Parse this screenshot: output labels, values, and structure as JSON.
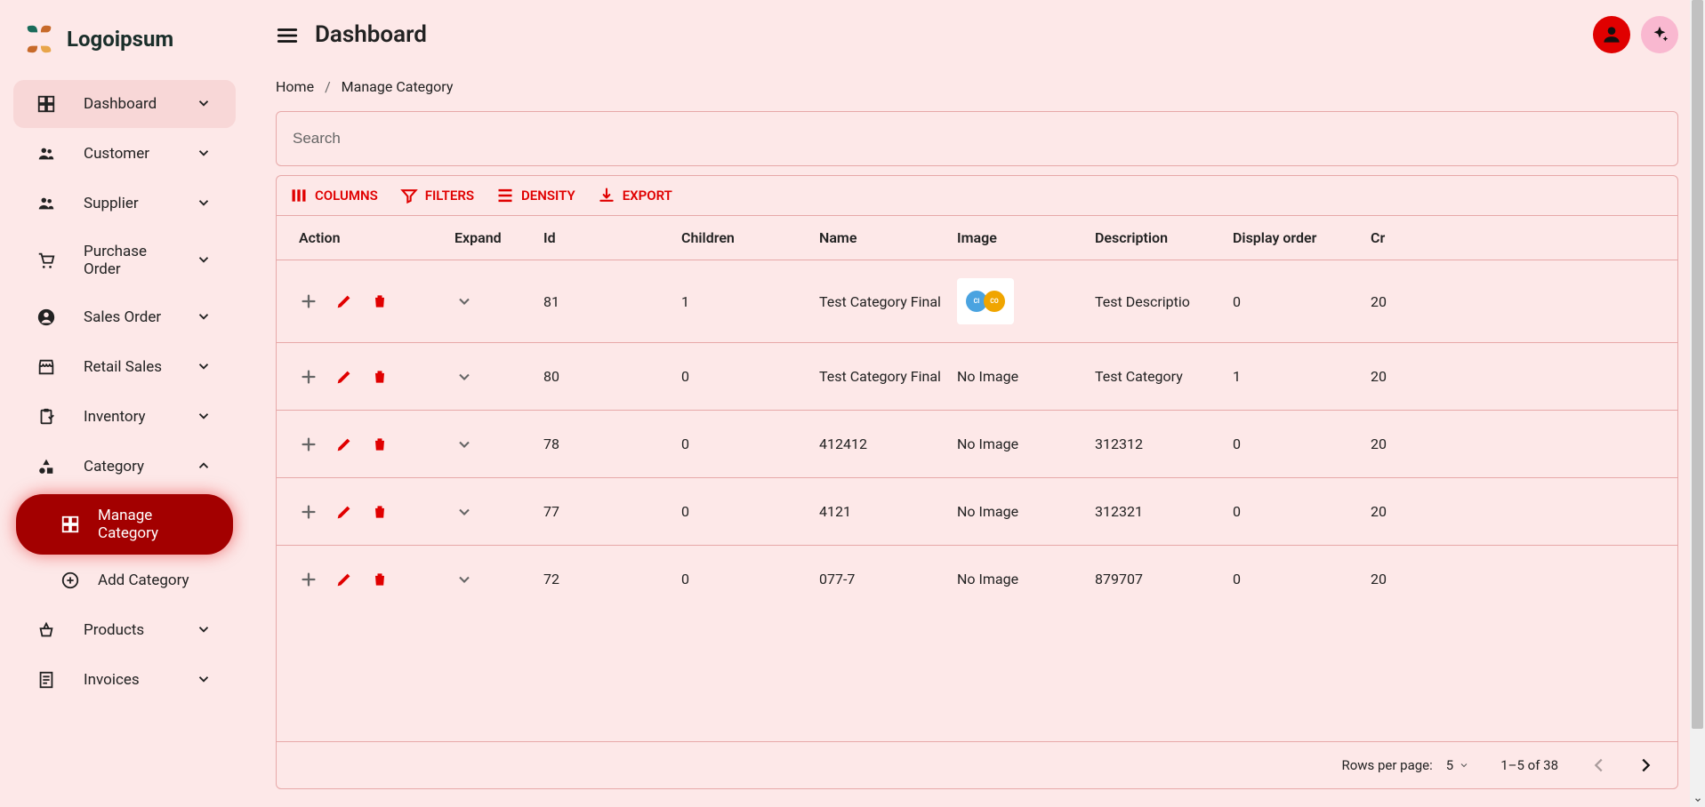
{
  "brand": "Logoipsum",
  "header": {
    "title": "Dashboard"
  },
  "breadcrumb": {
    "home": "Home",
    "current": "Manage Category"
  },
  "search": {
    "placeholder": "Search"
  },
  "sidebar": {
    "items": [
      {
        "label": "Dashboard",
        "icon": "dashboard"
      },
      {
        "label": "Customer",
        "icon": "group"
      },
      {
        "label": "Supplier",
        "icon": "group"
      },
      {
        "label": "Purchase Order",
        "icon": "cart"
      },
      {
        "label": "Sales Order",
        "icon": "account"
      },
      {
        "label": "Retail Sales",
        "icon": "store"
      },
      {
        "label": "Inventory",
        "icon": "clipboard"
      },
      {
        "label": "Category",
        "icon": "shapes",
        "expanded": true
      },
      {
        "label": "Products",
        "icon": "basket"
      },
      {
        "label": "Invoices",
        "icon": "receipt"
      }
    ],
    "category_children": [
      {
        "label": "Manage Category",
        "active": true,
        "icon": "dashboard"
      },
      {
        "label": "Add Category",
        "active": false,
        "icon": "plus-circle"
      }
    ]
  },
  "toolbar": {
    "columns": "COLUMNS",
    "filters": "FILTERS",
    "density": "DENSITY",
    "export": "EXPORT"
  },
  "table": {
    "headers": {
      "action": "Action",
      "expand": "Expand",
      "id": "Id",
      "children": "Children",
      "name": "Name",
      "image": "Image",
      "description": "Description",
      "display_order": "Display order",
      "created": "Cr"
    },
    "rows": [
      {
        "id": "81",
        "children": "1",
        "name": "Test Category Final",
        "image": "thumb",
        "description": "Test Descriptio",
        "order": "0",
        "cr": "20"
      },
      {
        "id": "80",
        "children": "0",
        "name": "Test Category Final",
        "image": "none",
        "description": "Test Category",
        "order": "1",
        "cr": "20"
      },
      {
        "id": "78",
        "children": "0",
        "name": "412412",
        "image": "none",
        "description": "312312",
        "order": "0",
        "cr": "20"
      },
      {
        "id": "77",
        "children": "0",
        "name": "4121",
        "image": "none",
        "description": "312321",
        "order": "0",
        "cr": "20"
      },
      {
        "id": "72",
        "children": "0",
        "name": "077-7",
        "image": "none",
        "description": "879707",
        "order": "0",
        "cr": "20"
      }
    ],
    "no_image_text": "No Image"
  },
  "pagination": {
    "rows_per_page_label": "Rows per page:",
    "rows_per_page_value": "5",
    "range": "1–5 of 38"
  },
  "colors": {
    "primary": "#e00000",
    "surface": "#fde8e8"
  }
}
